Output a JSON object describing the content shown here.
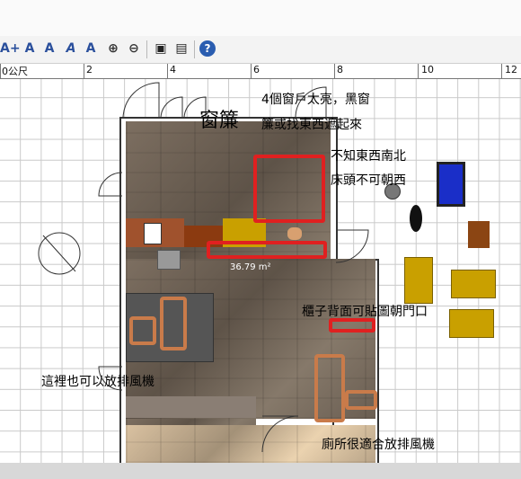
{
  "toolbar": {
    "icons": [
      "add-text-icon",
      "text-style-icon",
      "text-size-up-icon",
      "text-italic-icon",
      "text-bold-icon",
      "zoom-in-icon",
      "zoom-out-icon",
      "camera-icon",
      "video-icon",
      "help-icon"
    ],
    "glyphs": [
      "A+",
      "A",
      "A",
      "A",
      "A",
      "⊕",
      "⊖",
      "▣",
      "▤",
      "?"
    ]
  },
  "ruler": {
    "labels": [
      "0公尺",
      "2",
      "4",
      "6",
      "8",
      "10",
      "12"
    ]
  },
  "plan": {
    "title_label": "窗簾",
    "area_label": "36.79 m²",
    "notes": [
      "4個窗戶太亮，黑窗",
      "簾或找東西遮起來",
      "不知東西南北",
      "床頭不可朝西",
      "櫃子背面可貼圖朝門口",
      "這裡也可以放排風機",
      "廁所很適合放排風機"
    ]
  },
  "colors": {
    "annotation_red": "#e02020",
    "annotation_orange": "#c97b4a",
    "furniture_yellow": "#c9a000",
    "furniture_brown": "#8b4513",
    "selected_blue": "#1a2ec8"
  }
}
